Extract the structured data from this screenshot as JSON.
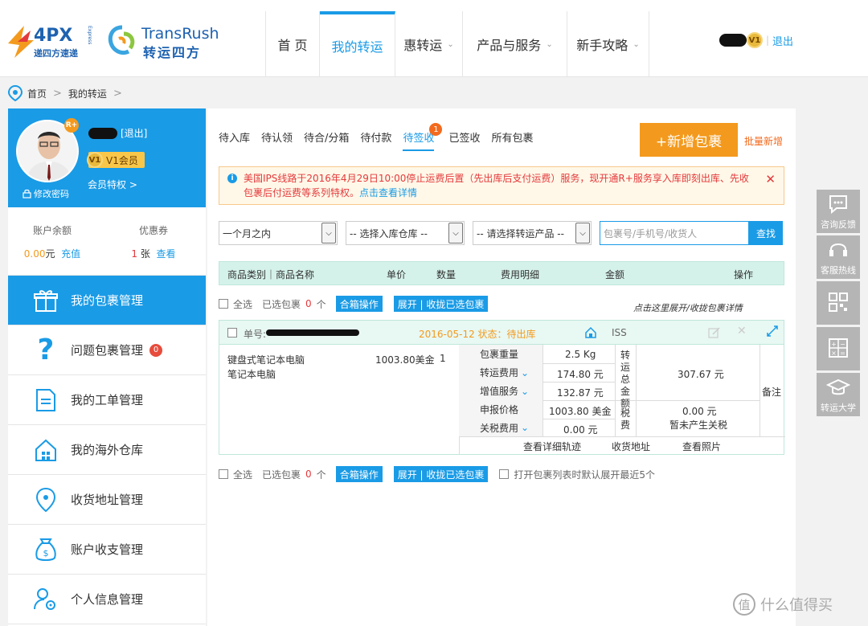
{
  "logo": {
    "brand1": "4PX",
    "brand1_sub": "递四方速递",
    "brand1_side": "Express",
    "brand2": "TransRush",
    "brand2_sub": "转运四方"
  },
  "nav": [
    {
      "label": "首 页",
      "caret": ""
    },
    {
      "label": "我的转运",
      "caret": ""
    },
    {
      "label": "惠转运",
      "caret": "⌄"
    },
    {
      "label": "产品与服务",
      "caret": "⌄"
    },
    {
      "label": "新手攻略",
      "caret": "⌄"
    }
  ],
  "user": {
    "badge": "V1",
    "logout": "退出"
  },
  "breadcrumb": {
    "home": "首页",
    "current": "我的转运",
    "sep": ">"
  },
  "profile": {
    "rplus": "R+",
    "logout": "[退出]",
    "vip": "V1会员",
    "badge": "V1",
    "change_password": "修改密码",
    "privilege": "会员特权 >"
  },
  "balance": {
    "title": "账户余额",
    "amount": "0.00",
    "unit": "元",
    "recharge": "充值"
  },
  "coupon": {
    "title": "优惠券",
    "count": "1",
    "unit": "张",
    "view": "查看"
  },
  "menu": [
    {
      "label": "我的包裹管理",
      "badge": ""
    },
    {
      "label": "问题包裹管理",
      "badge": "0"
    },
    {
      "label": "我的工单管理",
      "badge": ""
    },
    {
      "label": "我的海外仓库",
      "badge": ""
    },
    {
      "label": "收货地址管理",
      "badge": ""
    },
    {
      "label": "账户收支管理",
      "badge": ""
    },
    {
      "label": "个人信息管理",
      "badge": ""
    }
  ],
  "tabs": [
    {
      "label": "待入库",
      "dot": ""
    },
    {
      "label": "待认领",
      "dot": ""
    },
    {
      "label": "待合/分箱",
      "dot": ""
    },
    {
      "label": "待付款",
      "dot": ""
    },
    {
      "label": "待签收",
      "dot": "1"
    },
    {
      "label": "已签收",
      "dot": ""
    },
    {
      "label": "所有包裹",
      "dot": ""
    }
  ],
  "actions": {
    "add": "+新增包裹",
    "batch": "批量新增"
  },
  "notice": {
    "icon": "i",
    "text": "美国IPS线路于2016年4月29日10:00停止运费后置（先出库后支付运费）服务，现开通R+服务享入库即刻出库、先收包裹后付运费等系列特权。",
    "link": "点击查看详情",
    "close": "✕"
  },
  "filters": {
    "period": "一个月之内",
    "warehouse": "-- 选择入库仓库 --",
    "product": "-- 请选择转运产品 --",
    "search_placeholder": "包裹号/手机号/收货人",
    "search_btn": "查找"
  },
  "table_header": {
    "category": "商品类别｜商品名称",
    "price": "单价",
    "qty": "数量",
    "fee": "费用明细",
    "amount": "金额",
    "ops": "操作"
  },
  "bulk": {
    "select_all": "全选",
    "selected": "已选包裹",
    "count": "0",
    "unit": "个",
    "merge": "合箱操作",
    "toggle": "展开 | 收拢已选包裹",
    "default_expand": "打开包裹列表时默认展开最近5个"
  },
  "hint": "点击这里展开/收拢包裹详情",
  "package": {
    "no_label": "单号:",
    "date_status": "2016-05-12 状态：待出库",
    "carrier": "ISS",
    "item1": "键盘式笔记本电脑",
    "item2": "笔记本电脑",
    "unit_price": "1003.80美金",
    "qty": "1",
    "fees": [
      {
        "label": "包裹重量",
        "value": "2.5 Kg",
        "caret": ""
      },
      {
        "label": "转运费用",
        "value": "174.80 元",
        "caret": "⌄"
      },
      {
        "label": "增值服务",
        "value": "132.87 元",
        "caret": "⌄"
      },
      {
        "label": "申报价格",
        "value": "1003.80 美金",
        "caret": ""
      },
      {
        "label": "关税费用",
        "value": "0.00 元",
        "caret": "⌄"
      }
    ],
    "total_label": "转运总金额",
    "total": "307.67 元",
    "tax_label": "税费",
    "tax_value": "0.00 元",
    "tax_note": "暂未产生关税",
    "remark": "备注",
    "links": [
      "查看详细轨迹",
      "收货地址",
      "查看照片"
    ]
  },
  "rightbar": [
    "咨询反馈",
    "客服热线",
    "",
    "",
    "转运大学"
  ],
  "watermark": {
    "icon": "值",
    "text": "什么值得买"
  }
}
